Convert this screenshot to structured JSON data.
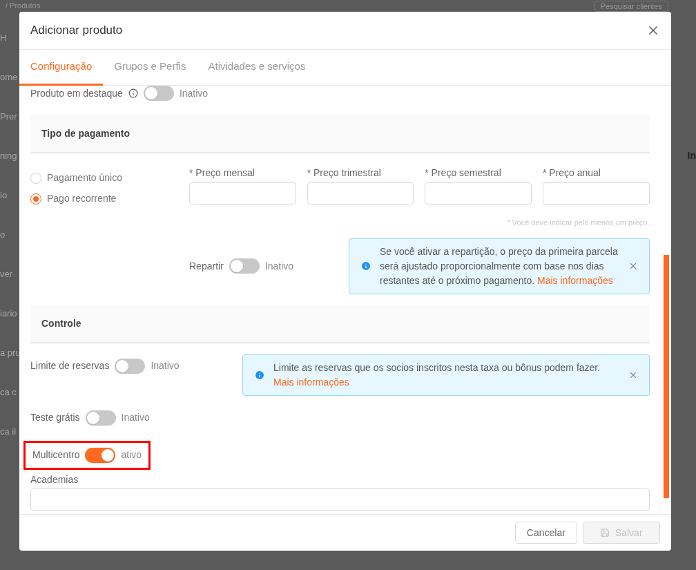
{
  "background": {
    "breadcrumb": "/ Produtos",
    "search": {
      "placeholder": "Pesquisar clientes"
    },
    "left_fragments": [
      "H",
      "ome",
      "Prer",
      "ning",
      "io",
      "o",
      "ver",
      "iario",
      "a pru",
      "ca c",
      "ca il"
    ],
    "right_fragments": [
      "In"
    ]
  },
  "window": {
    "title": "Adicionar produto"
  },
  "tabs": [
    {
      "label": "Configuração",
      "selected": true
    },
    {
      "label": "Grupos e Perfis",
      "selected": false
    },
    {
      "label": "Atividades e serviços",
      "selected": false
    }
  ],
  "featured": {
    "label": "Produto em destaque",
    "on": false,
    "status": "Inativo"
  },
  "payment": {
    "title": "Tipo de pagamento",
    "options": [
      {
        "label": "Pagamento único",
        "selected": false
      },
      {
        "label": "Pago recorrente",
        "selected": true
      }
    ],
    "prices": [
      {
        "label": "* Preço mensal"
      },
      {
        "label": "* Preço trimestral"
      },
      {
        "label": "* Preço semestral"
      },
      {
        "label": "* Preço anual"
      }
    ],
    "note": "* Você deve indicar pelo menos um preço.",
    "split": {
      "label": "Repartir",
      "on": false,
      "status": "Inativo"
    },
    "alert": {
      "text": "Se você ativar a repartição, o preço da primeira parcela será ajustado proporcionalmente com base nos dias restantes até o próximo pagamento.",
      "link": "Mais informações"
    }
  },
  "control": {
    "title": "Controle",
    "limit": {
      "label": "Limite de reservas",
      "on": false,
      "status": "Inativo"
    },
    "alert": {
      "text": "Limite as reservas que os socios inscritos nesta taxa ou bônus podem fazer.",
      "link": "Mais informações"
    },
    "trial": {
      "label": "Teste grátis",
      "on": false,
      "status": "Inativo"
    },
    "multicenter": {
      "label": "Multicentro",
      "on": true,
      "status": "ativo",
      "highlighted": true
    },
    "gyms": {
      "label": "Academias"
    }
  },
  "footer": {
    "buttons": [
      {
        "label": "Cancelar",
        "kind": "cancel",
        "disabled": false
      },
      {
        "label": "Salvar",
        "kind": "save",
        "disabled": true
      }
    ]
  }
}
